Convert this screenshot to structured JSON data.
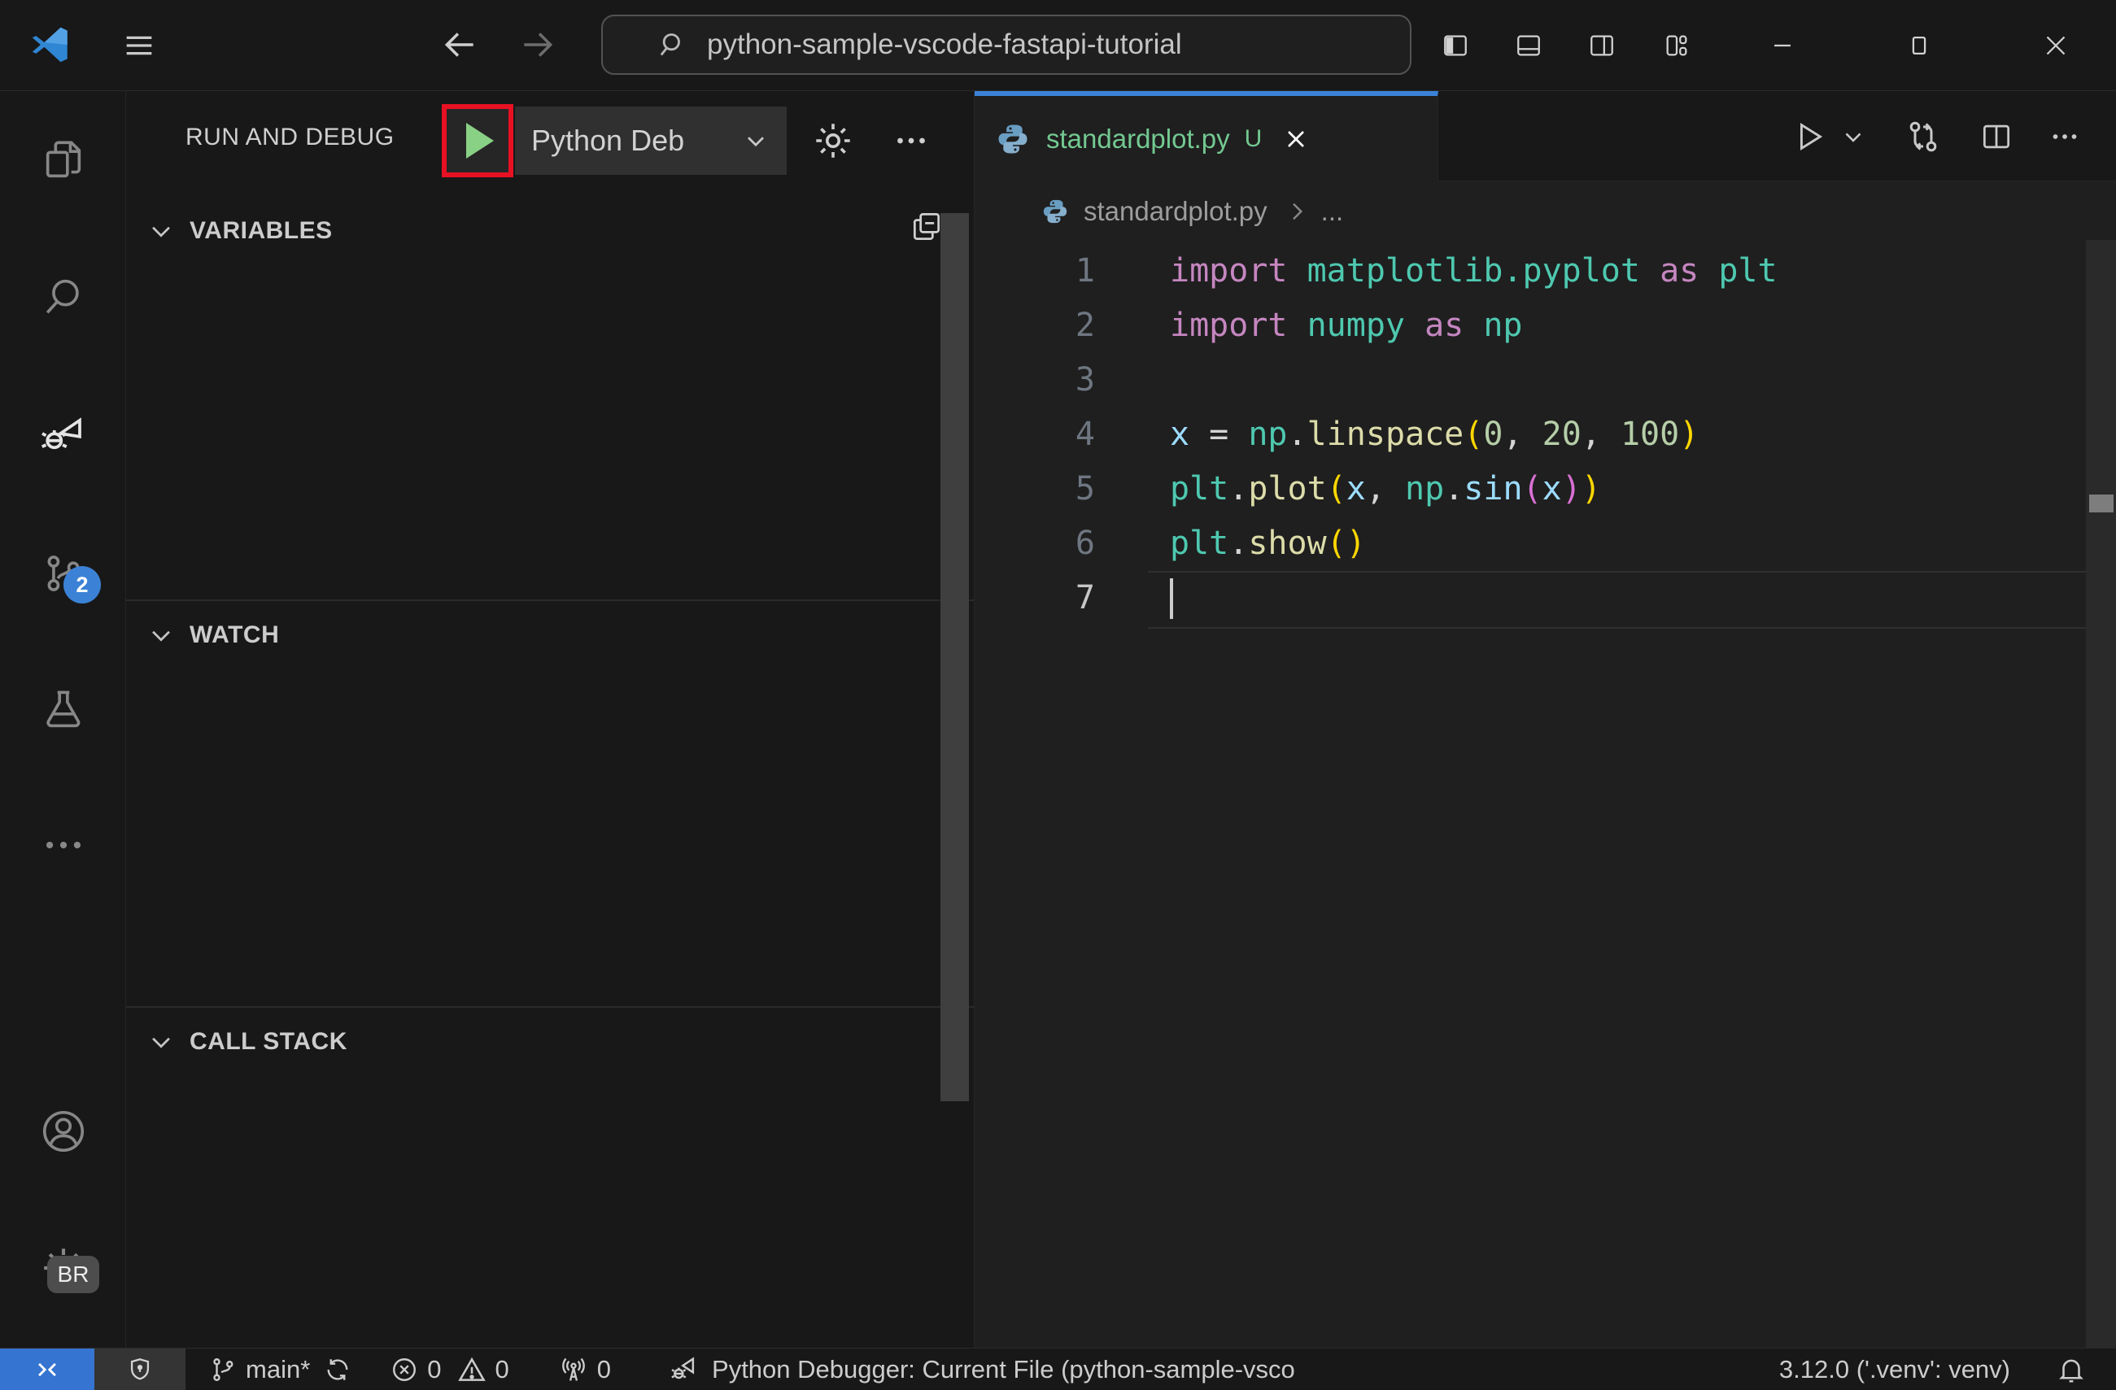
{
  "colors": {
    "accent": "#3b82d9",
    "remote_blue": "#3574d0",
    "badge_blue": "#3b82d6",
    "play_green": "#89d185",
    "annotation_red": "#e81123",
    "untracked_green": "#73c991",
    "syntax": {
      "kw": "#C586C0",
      "mod": "#4EC9B0",
      "var": "#9CDCFE",
      "fn": "#DCDCAA",
      "num": "#B5CEA8",
      "op": "#d4d4d4",
      "b1": "#ffd700",
      "b2": "#da70d6",
      "ln": "#6e7681",
      "lnActive": "#c6c6c6"
    }
  },
  "titlebar": {
    "search_value": "python-sample-vscode-fastapi-tutorial",
    "icons": [
      "vscode-logo",
      "menu",
      "arrow-back",
      "arrow-forward",
      "search",
      "layout-sidebar-left",
      "layout-panel",
      "layout-sidebar-right",
      "customize-layout",
      "minimize",
      "maximize",
      "close"
    ]
  },
  "activity_bar": {
    "items": [
      "explorer",
      "search",
      "run-and-debug",
      "source-control",
      "testing",
      "more"
    ],
    "bottom_items": [
      "accounts",
      "settings"
    ],
    "source_control_badge": "2",
    "settings_badge": "BR",
    "active_item": "run-and-debug"
  },
  "sidebar": {
    "title": "RUN AND DEBUG",
    "debug_config": "Python Deb",
    "toolbar_icons": [
      "start-debugging-play",
      "chevron-down",
      "gear",
      "ellipsis"
    ],
    "sections": [
      {
        "label": "VARIABLES"
      },
      {
        "label": "WATCH"
      },
      {
        "label": "CALL STACK"
      }
    ],
    "variables_action_icon": "collapse-all"
  },
  "editor": {
    "tab": {
      "filename": "standardplot.py",
      "modified_badge": "U",
      "icons": [
        "python-file",
        "close"
      ]
    },
    "actions": [
      "run-python-file",
      "run-dropdown-chevron",
      "open-changes",
      "split-editor",
      "more-actions"
    ],
    "breadcrumb": {
      "file": "standardplot.py",
      "symbol": "..."
    },
    "code": {
      "lines": [
        {
          "n": "1",
          "tokens": [
            {
              "t": "import ",
              "c": "kw"
            },
            {
              "t": "matplotlib.pyplot",
              "c": "mod"
            },
            {
              "t": " as ",
              "c": "kw"
            },
            {
              "t": "plt",
              "c": "mod"
            }
          ]
        },
        {
          "n": "2",
          "tokens": [
            {
              "t": "import ",
              "c": "kw"
            },
            {
              "t": "numpy",
              "c": "mod"
            },
            {
              "t": " as ",
              "c": "kw"
            },
            {
              "t": "np",
              "c": "mod"
            }
          ]
        },
        {
          "n": "3",
          "tokens": []
        },
        {
          "n": "4",
          "tokens": [
            {
              "t": "x",
              "c": "var"
            },
            {
              "t": " = ",
              "c": "op"
            },
            {
              "t": "np",
              "c": "mod"
            },
            {
              "t": ".",
              "c": "op"
            },
            {
              "t": "linspace",
              "c": "fn"
            },
            {
              "t": "(",
              "c": "b1"
            },
            {
              "t": "0",
              "c": "num"
            },
            {
              "t": ", ",
              "c": "op"
            },
            {
              "t": "20",
              "c": "num"
            },
            {
              "t": ", ",
              "c": "op"
            },
            {
              "t": "100",
              "c": "num"
            },
            {
              "t": ")",
              "c": "b1"
            }
          ]
        },
        {
          "n": "5",
          "tokens": [
            {
              "t": "plt",
              "c": "mod"
            },
            {
              "t": ".",
              "c": "op"
            },
            {
              "t": "plot",
              "c": "fn"
            },
            {
              "t": "(",
              "c": "b1"
            },
            {
              "t": "x",
              "c": "var"
            },
            {
              "t": ", ",
              "c": "op"
            },
            {
              "t": "np",
              "c": "mod"
            },
            {
              "t": ".",
              "c": "op"
            },
            {
              "t": "sin",
              "c": "var"
            },
            {
              "t": "(",
              "c": "b2"
            },
            {
              "t": "x",
              "c": "var"
            },
            {
              "t": ")",
              "c": "b2"
            },
            {
              "t": ")",
              "c": "b1"
            }
          ]
        },
        {
          "n": "6",
          "tokens": [
            {
              "t": "plt",
              "c": "mod"
            },
            {
              "t": ".",
              "c": "op"
            },
            {
              "t": "show",
              "c": "fn"
            },
            {
              "t": "(",
              "c": "b1"
            },
            {
              "t": ")",
              "c": "b1"
            }
          ]
        },
        {
          "n": "7",
          "tokens": [],
          "active": true,
          "cursor": true
        }
      ]
    }
  },
  "status_bar": {
    "icons": [
      "remote",
      "workspace-trust-shield",
      "git-branch",
      "sync",
      "errors",
      "warnings",
      "ports",
      "debug",
      "notifications-bell"
    ],
    "branch": "main*",
    "errors": "0",
    "warnings": "0",
    "ports": "0",
    "debug_status": "Python Debugger: Current File (python-sample-vsco",
    "python_version": "3.12.0 ('.venv': venv)"
  }
}
